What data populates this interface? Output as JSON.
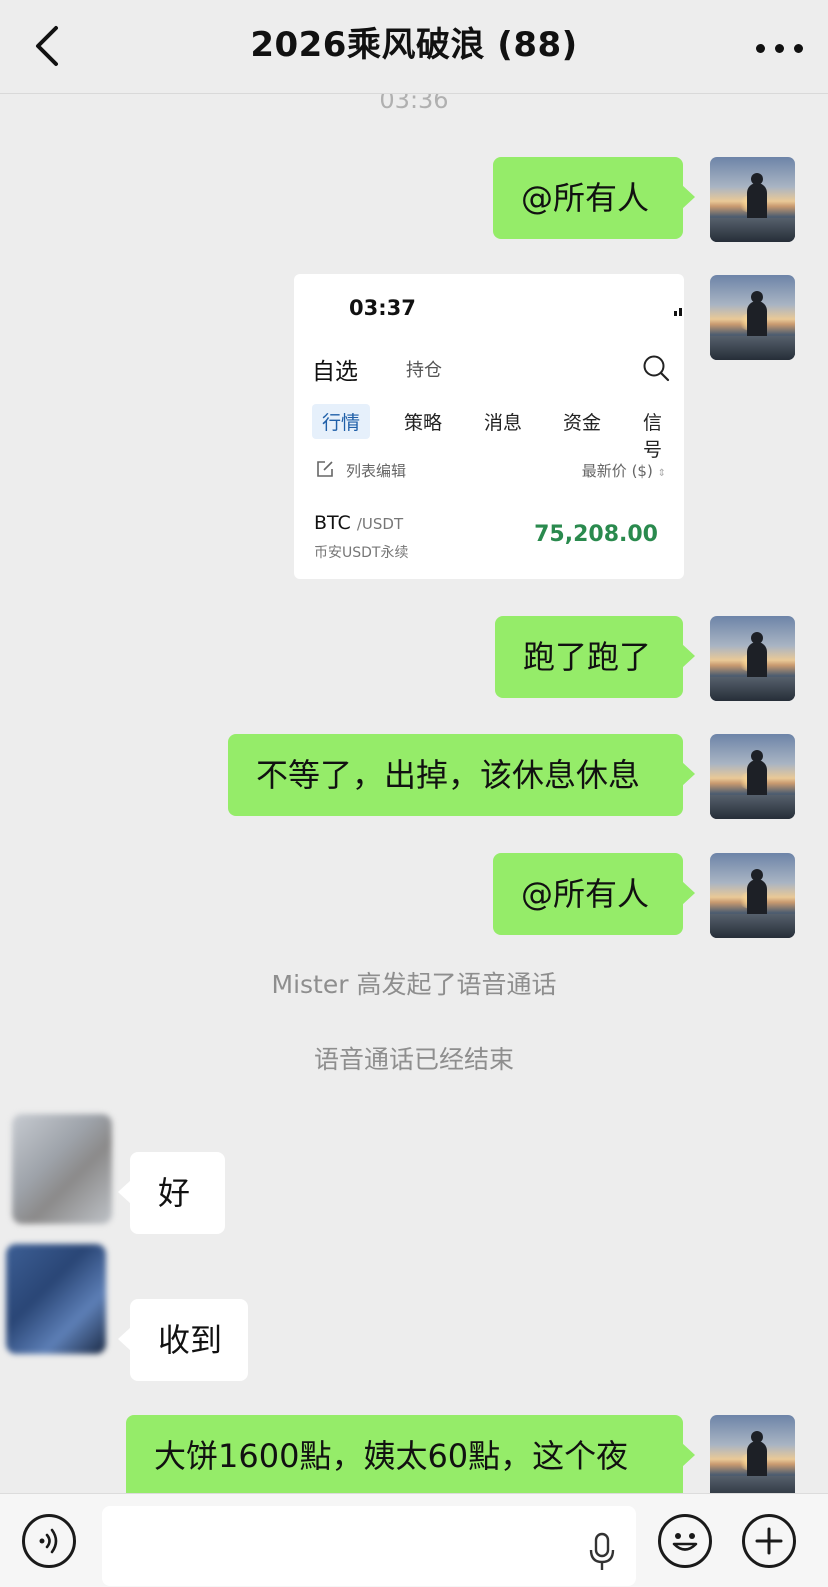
{
  "header": {
    "title": "2026乘风破浪 (88)"
  },
  "chat": {
    "timestamp": "03:36",
    "messages": [
      {
        "text": "@所有人"
      },
      {
        "text": "跑了跑了"
      },
      {
        "text": "不等了，出掉，该休息休息"
      },
      {
        "text": "@所有人"
      },
      {
        "text": "好"
      },
      {
        "text": "收到"
      },
      {
        "text": "大饼1600點，姨太60點，这个夜"
      }
    ],
    "system": [
      "Mister 高发起了语音通话",
      "语音通话已经结束"
    ]
  },
  "screenshot_card": {
    "time": "03:37",
    "tab_selected": "自选",
    "tab_other": "持仓",
    "chips": [
      "行情",
      "策略",
      "消息",
      "资金",
      "信号"
    ],
    "edit_label": "列表编辑",
    "latest_price_label": "最新价 ($)",
    "coin": "BTC",
    "pair": "/USDT",
    "exchange": "币安USDT永续",
    "price": "75,208.00"
  },
  "colors": {
    "bubble_green": "#95ec69",
    "price_green": "#2a8a4e",
    "background": "#ededed"
  },
  "icons": {
    "back": "back-arrow-icon",
    "more": "more-dots-icon",
    "voice": "voice-icon",
    "mic": "mic-icon",
    "emoji": "emoji-icon",
    "plus": "plus-icon"
  }
}
